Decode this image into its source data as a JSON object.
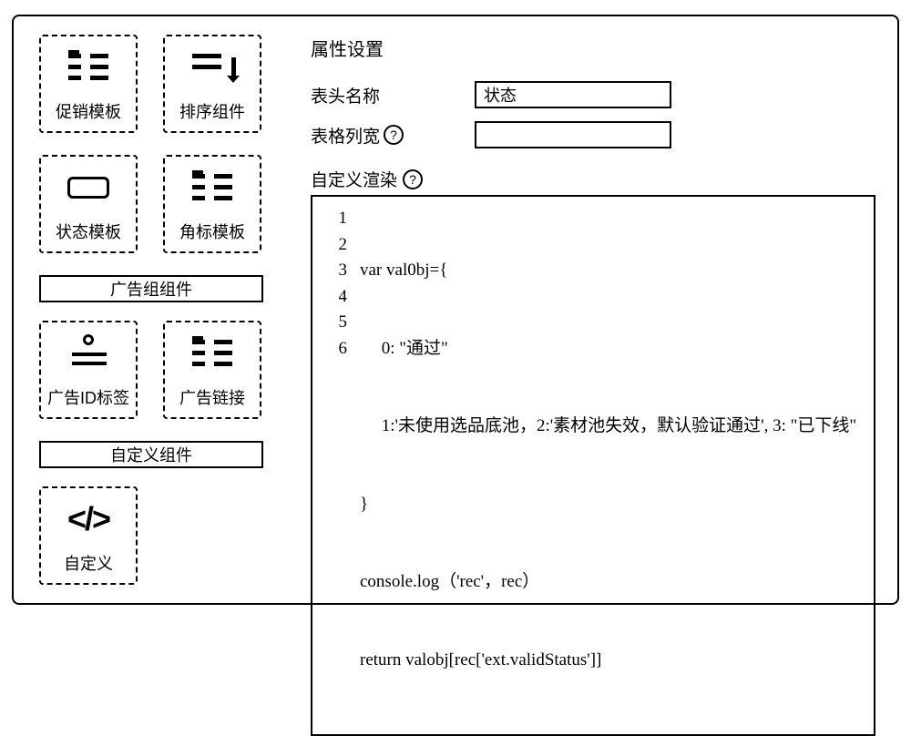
{
  "sidebar": {
    "tiles": [
      {
        "label": "促销模板"
      },
      {
        "label": "排序组件"
      },
      {
        "label": "状态模板"
      },
      {
        "label": "角标模板"
      }
    ],
    "group1_label": "广告组组件",
    "tiles2": [
      {
        "label": "广告ID标签"
      },
      {
        "label": "广告链接"
      }
    ],
    "group2_label": "自定义组件",
    "tiles3": [
      {
        "label": "自定义"
      }
    ]
  },
  "main": {
    "section_title": "属性设置",
    "field1_label": "表头名称",
    "field1_value": "状态",
    "field2_label": "表格列宽",
    "field2_value": "",
    "render_label": "自定义渲染",
    "code": {
      "line1": "var val0bj={",
      "line2": "     0: \"通过\"",
      "line3": "     1:'未使用选品底池，2:'素材池失效，默认验证通过', 3: \"已下线\"",
      "line4": "}",
      "line5": "console.log（'rec'，rec）",
      "line6": "return valobj[rec['ext.validStatus']]"
    },
    "line_numbers": [
      "1",
      "2",
      "3",
      "4",
      "5",
      "6"
    ]
  }
}
